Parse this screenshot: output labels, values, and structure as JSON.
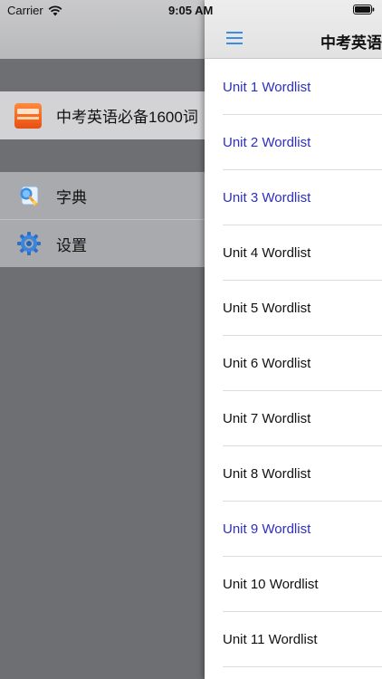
{
  "status_bar": {
    "carrier": "Carrier",
    "time": "9:05 AM"
  },
  "drawer": {
    "app_title": "中考英语必备1600词",
    "menu": [
      {
        "label": "字典",
        "icon": "dictionary-icon"
      },
      {
        "label": "设置",
        "icon": "gear-icon"
      }
    ]
  },
  "nav": {
    "title": "中考英语",
    "menu_icon": "hamburger-menu-icon"
  },
  "colors": {
    "visited_link": "#2d2fbf",
    "hamburger": "#3a8de0"
  },
  "wordlists": [
    {
      "label": "Unit 1 Wordlist",
      "visited": true
    },
    {
      "label": "Unit 2 Wordlist",
      "visited": true
    },
    {
      "label": "Unit 3 Wordlist",
      "visited": true
    },
    {
      "label": "Unit 4 Wordlist",
      "visited": false
    },
    {
      "label": "Unit 5 Wordlist",
      "visited": false
    },
    {
      "label": "Unit 6 Wordlist",
      "visited": false
    },
    {
      "label": "Unit 7 Wordlist",
      "visited": false
    },
    {
      "label": "Unit 8 Wordlist",
      "visited": false
    },
    {
      "label": "Unit 9 Wordlist",
      "visited": true
    },
    {
      "label": "Unit 10 Wordlist",
      "visited": false
    },
    {
      "label": "Unit 11 Wordlist",
      "visited": false
    }
  ]
}
